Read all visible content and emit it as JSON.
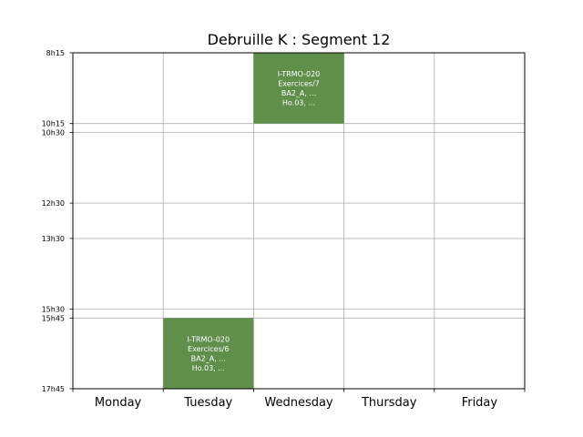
{
  "chart_data": {
    "type": "timetable",
    "title": "Debruille K : Segment 12",
    "days": [
      "Monday",
      "Tuesday",
      "Wednesday",
      "Thursday",
      "Friday"
    ],
    "ylim": [
      "8h15",
      "17h45"
    ],
    "time_ticks": [
      "8h15",
      "10h15",
      "10h30",
      "12h30",
      "13h30",
      "15h30",
      "15h45",
      "17h45"
    ],
    "grid": true,
    "event_color": "#5f8f4a",
    "events": [
      {
        "day": "Wednesday",
        "start": "8h15",
        "end": "10h15",
        "lines": [
          "I-TRMO-020",
          "Exercices/7",
          "BA2_A, ...",
          "Ho.03, ..."
        ]
      },
      {
        "day": "Tuesday",
        "start": "15h45",
        "end": "17h45",
        "lines": [
          "I-TRMO-020",
          "Exercices/6",
          "BA2_A, ...",
          "Ho.03, ..."
        ]
      }
    ]
  }
}
